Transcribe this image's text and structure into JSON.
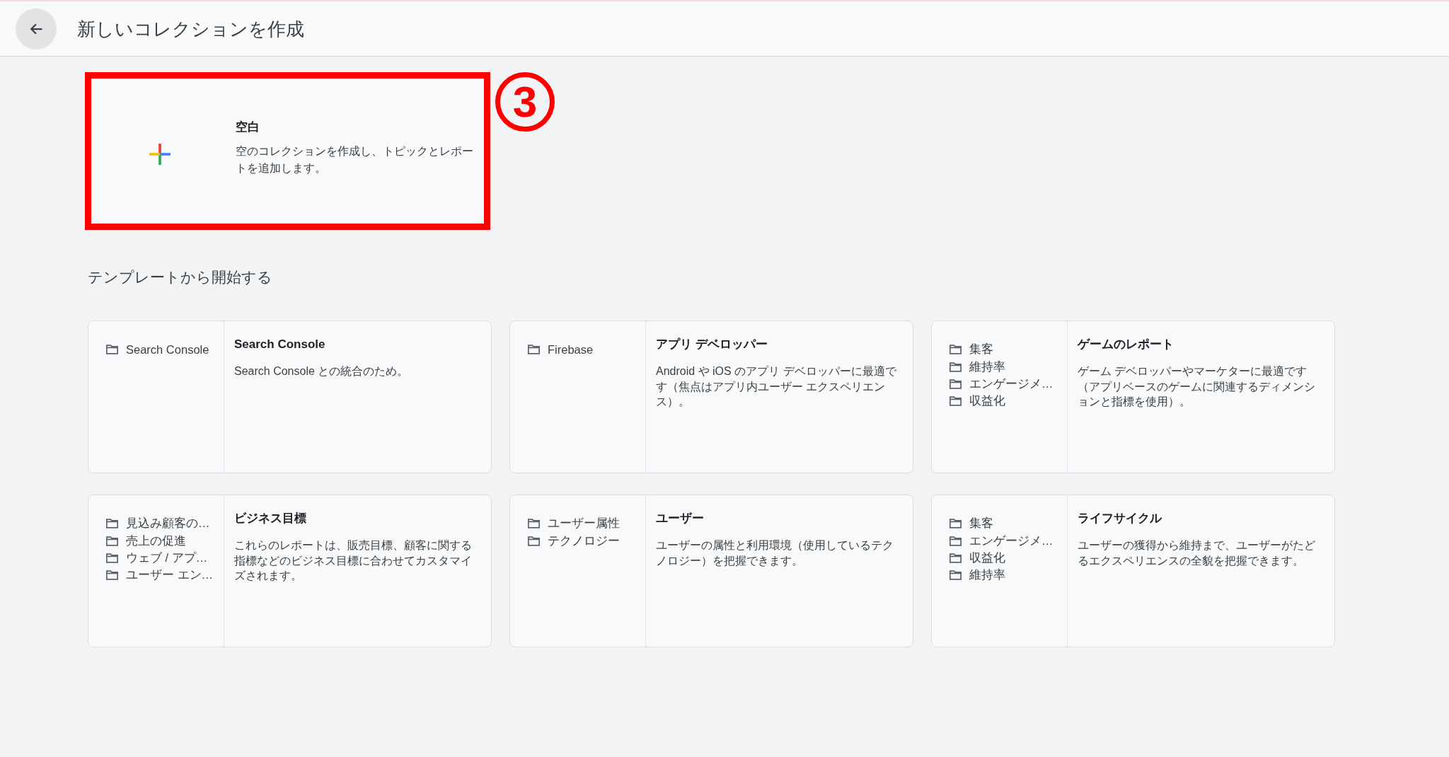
{
  "header": {
    "title": "新しいコレクションを作成"
  },
  "blank_collection": {
    "title": "空白",
    "description": "空のコレクションを作成し、トピックとレポートを追加します。",
    "highlighted": true
  },
  "step_marker": {
    "number": "3"
  },
  "templates_section": {
    "heading": "テンプレートから開始する",
    "templates": [
      {
        "folders": [
          "Search Console"
        ],
        "title": "Search Console",
        "description": "Search Console との統合のため。"
      },
      {
        "folders": [
          "Firebase"
        ],
        "title": "アプリ デベロッパー",
        "description": "Android や iOS のアプリ デベロッパーに最適です（焦点はアプリ内ユーザー エクスペリエンス）。"
      },
      {
        "folders": [
          "集客",
          "維持率",
          "エンゲージメ…",
          "収益化"
        ],
        "title": "ゲームのレポート",
        "description": "ゲーム デベロッパーやマーケターに最適です（アプリベースのゲームに関連するディメンションと指標を使用）。"
      },
      {
        "folders": [
          "見込み顧客の…",
          "売上の促進",
          "ウェブ / アプ…",
          "ユーザー エン…"
        ],
        "title": "ビジネス目標",
        "description": "これらのレポートは、販売目標、顧客に関する指標などのビジネス目標に合わせてカスタマイズされます。"
      },
      {
        "folders": [
          "ユーザー属性",
          "テクノロジー"
        ],
        "title": "ユーザー",
        "description": "ユーザーの属性と利用環境（使用しているテクノロジー）を把握できます。"
      },
      {
        "folders": [
          "集客",
          "エンゲージメ…",
          "収益化",
          "維持率"
        ],
        "title": "ライフサイクル",
        "description": "ユーザーの獲得から維持まで、ユーザーがたどるエクスペリエンスの全貌を把握できます。"
      }
    ]
  }
}
